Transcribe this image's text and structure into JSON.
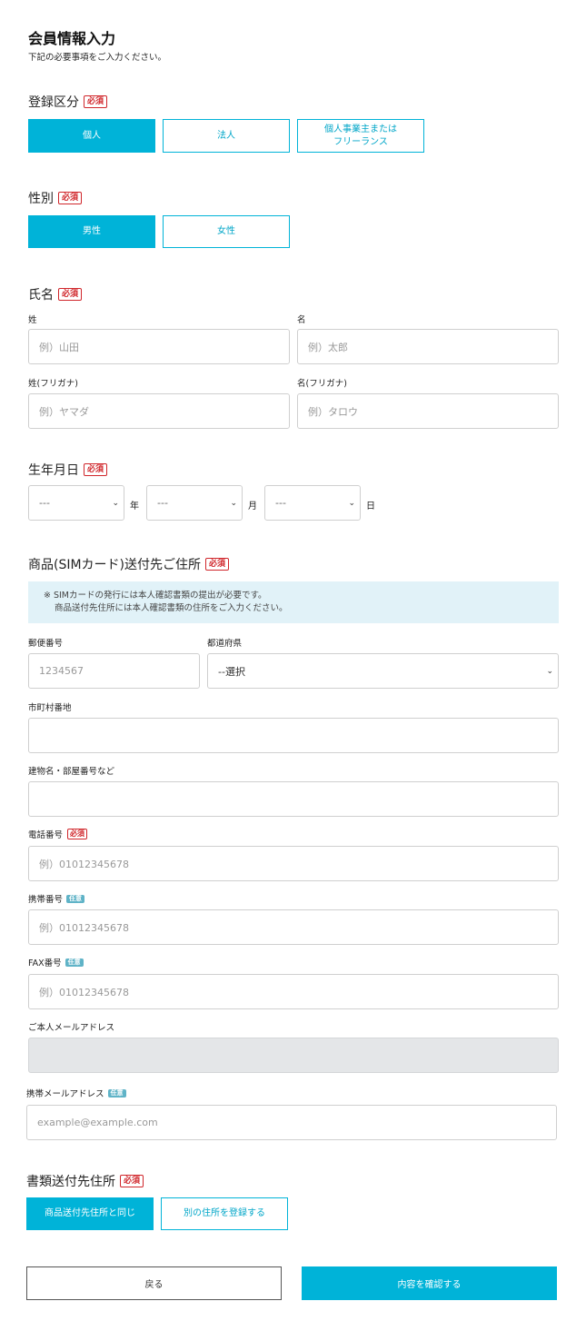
{
  "page": {
    "title": "会員情報入力",
    "subtitle": "下記の必要事項をご入力ください。"
  },
  "badges": {
    "required": "必須",
    "optional": "任意"
  },
  "registration": {
    "label": "登録区分",
    "options": [
      "個人",
      "法人",
      "個人事業主または",
      "フリーランス"
    ],
    "selected": "個人"
  },
  "gender": {
    "label": "性別",
    "options": [
      "男性",
      "女性"
    ],
    "selected": "男性"
  },
  "name": {
    "label": "氏名",
    "last_label": "姓",
    "first_label": "名",
    "last_placeholder": "例）山田",
    "first_placeholder": "例）太郎",
    "last_kana_label": "姓(フリガナ)",
    "first_kana_label": "名(フリガナ)",
    "last_kana_placeholder": "例）ヤマダ",
    "first_kana_placeholder": "例）タロウ"
  },
  "birthdate": {
    "label": "生年月日",
    "year_value": "---",
    "month_value": "---",
    "day_value": "---",
    "year_unit": "年",
    "month_unit": "月",
    "day_unit": "日"
  },
  "address": {
    "label": "商品(SIMカード)送付先ご住所",
    "notice_line1": "※ SIMカードの発行には本人確認書類の提出が必要です。",
    "notice_line2": "商品送付先住所には本人確認書類の住所をご入力ください。",
    "postal_label": "郵便番号",
    "postal_placeholder": "1234567",
    "prefecture_label": "都道府県",
    "prefecture_value": "--選択",
    "city_label": "市町村番地",
    "building_label": "建物名・部屋番号など",
    "phone_label": "電話番号",
    "phone_placeholder": "例）01012345678",
    "mobile_label": "携帯番号",
    "mobile_placeholder": "例）01012345678",
    "fax_label": "FAX番号",
    "fax_placeholder": "例）01012345678",
    "email_label": "ご本人メールアドレス",
    "mobile_email_label": "携帯メールアドレス",
    "mobile_email_placeholder": "example@example.com"
  },
  "documents": {
    "label": "書類送付先住所",
    "options": [
      "商品送付先住所と同じ",
      "別の住所を登録する"
    ],
    "selected": "商品送付先住所と同じ"
  },
  "actions": {
    "back": "戻る",
    "confirm": "内容を確認する"
  },
  "colors": {
    "accent": "#00b3d8",
    "required": "#d0262b",
    "optional": "#5fb3c7",
    "notice_bg": "#e1f2f8"
  }
}
